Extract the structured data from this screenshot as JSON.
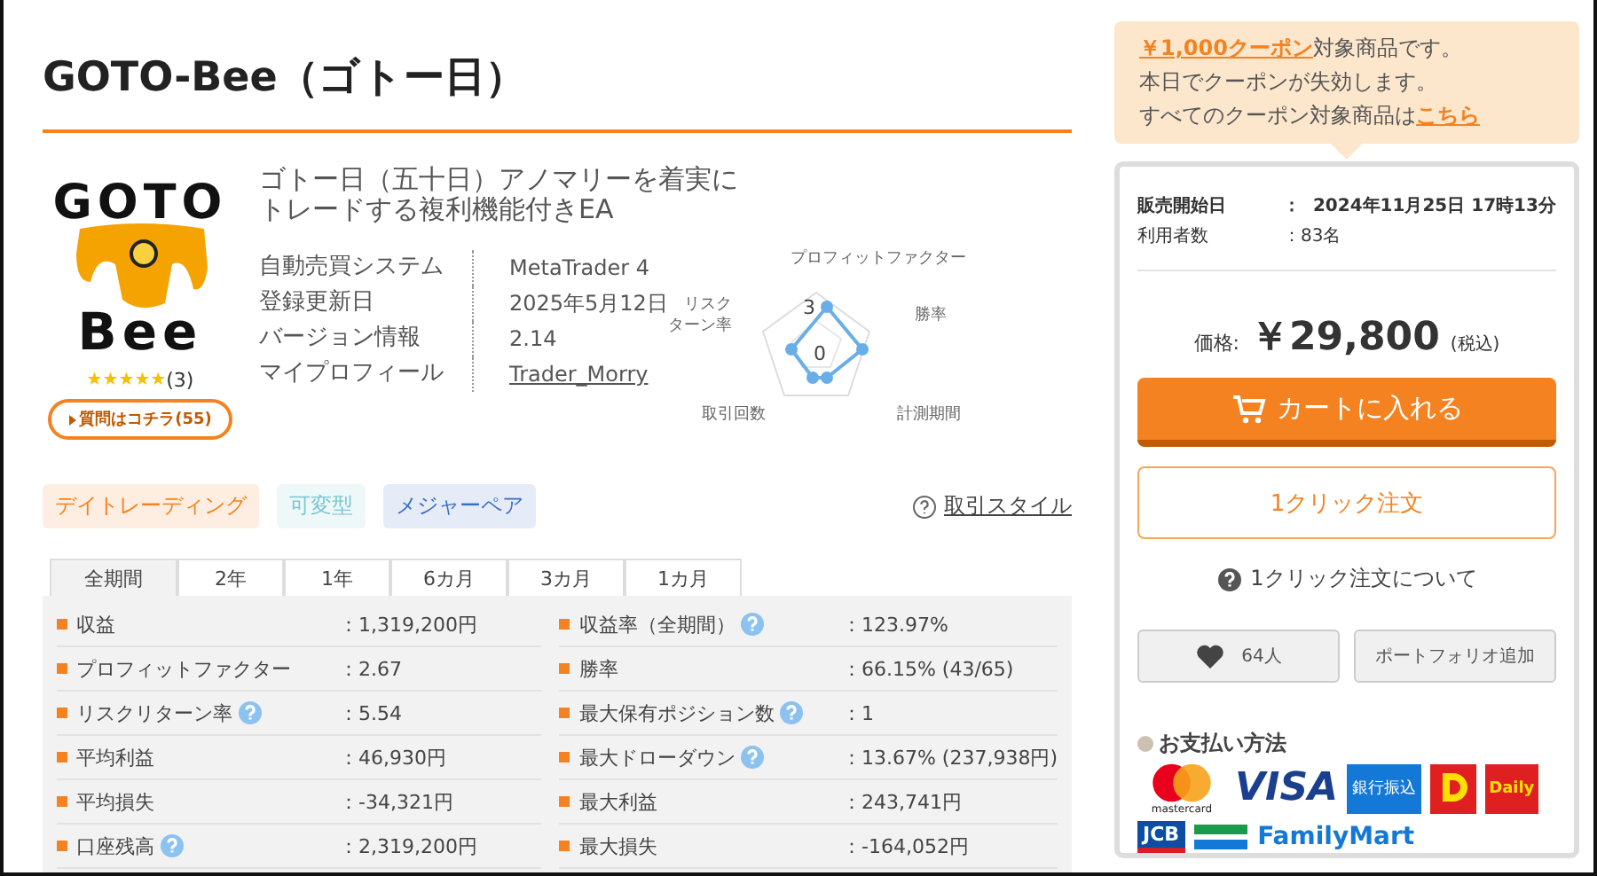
{
  "title": "GOTO-Bee（ゴトー日）",
  "product": {
    "logo": {
      "top": "GOTO",
      "bottom": "Bee"
    },
    "stars": 5,
    "review_count": "(3)",
    "question_button": "質問はコチラ(55)",
    "subtitle": "ゴトー日（五十日）アノマリーを着実にトレードする複利機能付きEA",
    "info": [
      {
        "label": "自動売買システム",
        "value": "MetaTrader 4",
        "kind": "text"
      },
      {
        "label": "登録更新日",
        "value": "2025年5月12日",
        "kind": "text"
      },
      {
        "label": "バージョン情報",
        "value": "2.14",
        "kind": "text"
      },
      {
        "label": "マイプロフィール",
        "value": "Trader_Morry",
        "kind": "link"
      }
    ],
    "radar": {
      "axes": [
        [
          "プロフィットファクター"
        ],
        [
          "勝率"
        ],
        [
          "計測期間"
        ],
        [
          "取引回数"
        ],
        [
          "リスク",
          "ターン率"
        ]
      ],
      "ticks": [
        "3",
        "0"
      ]
    }
  },
  "tags": [
    {
      "label": "デイトレーディング",
      "color": "#f58220"
    },
    {
      "label": "可変型",
      "color": "#7cc7d0"
    },
    {
      "label": "メジャーペア",
      "color": "#3a6fc4"
    }
  ],
  "style_link": "取引スタイル",
  "period_tabs": [
    {
      "label": "全期間",
      "selected": true
    },
    {
      "label": "2年",
      "selected": false
    },
    {
      "label": "1年",
      "selected": false
    },
    {
      "label": "6カ月",
      "selected": false
    },
    {
      "label": "3カ月",
      "selected": false
    },
    {
      "label": "1カ月",
      "selected": false
    }
  ],
  "stats_left": [
    {
      "label": "収益",
      "value": "：1,319,200円",
      "help": false
    },
    {
      "label": "プロフィットファクター",
      "value": "：2.67",
      "help": false
    },
    {
      "label": "リスクリターン率",
      "value": "：5.54",
      "help": true
    },
    {
      "label": "平均利益",
      "value": "：46,930円",
      "help": false
    },
    {
      "label": "平均損失",
      "value": "：-34,321円",
      "help": false
    },
    {
      "label": "口座残高",
      "value": "：2,319,200円",
      "help": true
    }
  ],
  "stats_right": [
    {
      "label": "収益率（全期間）",
      "value": "：123.97%",
      "help": true
    },
    {
      "label": "勝率",
      "value": "：66.15% (43/65)",
      "help": false
    },
    {
      "label": "最大保有ポジション数",
      "value": "：1",
      "help": true
    },
    {
      "label": "最大ドローダウン",
      "value": "：13.67% (237,938円)",
      "help": true
    },
    {
      "label": "最大利益",
      "value": "：243,741円",
      "help": false
    },
    {
      "label": "最大損失",
      "value": "：-164,052円",
      "help": false
    }
  ],
  "coupon": {
    "amount_link": "￥1,000クーポン",
    "line1_rest": "対象商品です。",
    "line2": "本日でクーポンが失効します。",
    "line3": "すべてのクーポン対象商品は",
    "here_link": "こちら"
  },
  "sale": {
    "rows": [
      {
        "label": "販売開始日",
        "value": "：  2024年11月25日 17時13分",
        "bold": true
      },
      {
        "label": "利用者数",
        "value": "：83名",
        "bold": false
      }
    ],
    "price_label": "価格:",
    "price": "￥29,800",
    "tax": "(税込)",
    "cart_button": "カートに入れる",
    "one_click_button": "1クリック注文",
    "one_click_help": "1クリック注文について",
    "favorite_count": "64人",
    "portfolio_button": "ポートフォリオ追加"
  },
  "payment": {
    "title": "お支払い方法",
    "logos": [
      {
        "kind": "mastercard",
        "text": "mastercard"
      },
      {
        "kind": "visa",
        "text": "VISA"
      },
      {
        "kind": "bank",
        "text": "銀行振込"
      },
      {
        "kind": "daily-mark"
      },
      {
        "kind": "daily",
        "text": "Daily"
      },
      {
        "kind": "jcb",
        "text": "JCB"
      },
      {
        "kind": "familymart",
        "text": "FamilyMart"
      }
    ]
  }
}
